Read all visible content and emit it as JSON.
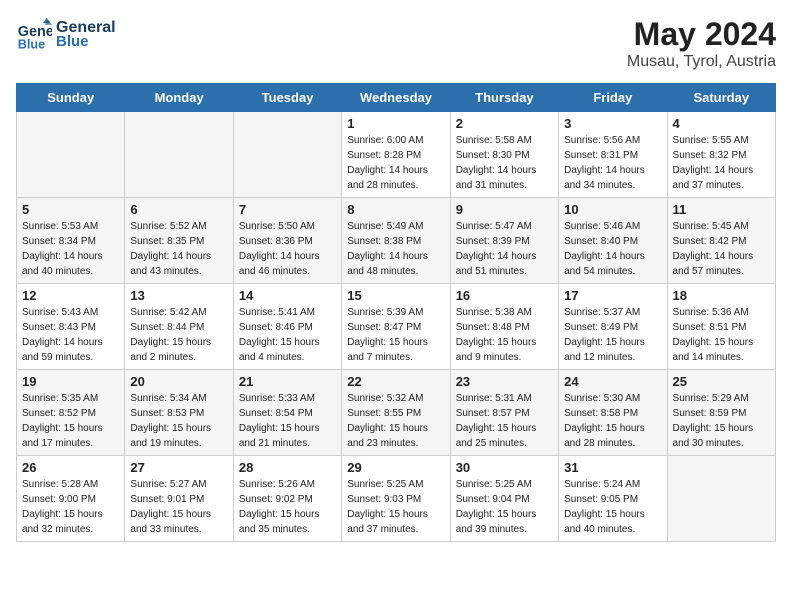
{
  "header": {
    "logo_line1": "General",
    "logo_line2": "Blue",
    "month": "May 2024",
    "location": "Musau, Tyrol, Austria"
  },
  "weekdays": [
    "Sunday",
    "Monday",
    "Tuesday",
    "Wednesday",
    "Thursday",
    "Friday",
    "Saturday"
  ],
  "weeks": [
    [
      {
        "day": "",
        "info": "",
        "empty": true
      },
      {
        "day": "",
        "info": "",
        "empty": true
      },
      {
        "day": "",
        "info": "",
        "empty": true
      },
      {
        "day": "1",
        "info": "Sunrise: 6:00 AM\nSunset: 8:28 PM\nDaylight: 14 hours\nand 28 minutes."
      },
      {
        "day": "2",
        "info": "Sunrise: 5:58 AM\nSunset: 8:30 PM\nDaylight: 14 hours\nand 31 minutes."
      },
      {
        "day": "3",
        "info": "Sunrise: 5:56 AM\nSunset: 8:31 PM\nDaylight: 14 hours\nand 34 minutes."
      },
      {
        "day": "4",
        "info": "Sunrise: 5:55 AM\nSunset: 8:32 PM\nDaylight: 14 hours\nand 37 minutes."
      }
    ],
    [
      {
        "day": "5",
        "info": "Sunrise: 5:53 AM\nSunset: 8:34 PM\nDaylight: 14 hours\nand 40 minutes."
      },
      {
        "day": "6",
        "info": "Sunrise: 5:52 AM\nSunset: 8:35 PM\nDaylight: 14 hours\nand 43 minutes."
      },
      {
        "day": "7",
        "info": "Sunrise: 5:50 AM\nSunset: 8:36 PM\nDaylight: 14 hours\nand 46 minutes."
      },
      {
        "day": "8",
        "info": "Sunrise: 5:49 AM\nSunset: 8:38 PM\nDaylight: 14 hours\nand 48 minutes."
      },
      {
        "day": "9",
        "info": "Sunrise: 5:47 AM\nSunset: 8:39 PM\nDaylight: 14 hours\nand 51 minutes."
      },
      {
        "day": "10",
        "info": "Sunrise: 5:46 AM\nSunset: 8:40 PM\nDaylight: 14 hours\nand 54 minutes."
      },
      {
        "day": "11",
        "info": "Sunrise: 5:45 AM\nSunset: 8:42 PM\nDaylight: 14 hours\nand 57 minutes."
      }
    ],
    [
      {
        "day": "12",
        "info": "Sunrise: 5:43 AM\nSunset: 8:43 PM\nDaylight: 14 hours\nand 59 minutes."
      },
      {
        "day": "13",
        "info": "Sunrise: 5:42 AM\nSunset: 8:44 PM\nDaylight: 15 hours\nand 2 minutes."
      },
      {
        "day": "14",
        "info": "Sunrise: 5:41 AM\nSunset: 8:46 PM\nDaylight: 15 hours\nand 4 minutes."
      },
      {
        "day": "15",
        "info": "Sunrise: 5:39 AM\nSunset: 8:47 PM\nDaylight: 15 hours\nand 7 minutes."
      },
      {
        "day": "16",
        "info": "Sunrise: 5:38 AM\nSunset: 8:48 PM\nDaylight: 15 hours\nand 9 minutes."
      },
      {
        "day": "17",
        "info": "Sunrise: 5:37 AM\nSunset: 8:49 PM\nDaylight: 15 hours\nand 12 minutes."
      },
      {
        "day": "18",
        "info": "Sunrise: 5:36 AM\nSunset: 8:51 PM\nDaylight: 15 hours\nand 14 minutes."
      }
    ],
    [
      {
        "day": "19",
        "info": "Sunrise: 5:35 AM\nSunset: 8:52 PM\nDaylight: 15 hours\nand 17 minutes."
      },
      {
        "day": "20",
        "info": "Sunrise: 5:34 AM\nSunset: 8:53 PM\nDaylight: 15 hours\nand 19 minutes."
      },
      {
        "day": "21",
        "info": "Sunrise: 5:33 AM\nSunset: 8:54 PM\nDaylight: 15 hours\nand 21 minutes."
      },
      {
        "day": "22",
        "info": "Sunrise: 5:32 AM\nSunset: 8:55 PM\nDaylight: 15 hours\nand 23 minutes."
      },
      {
        "day": "23",
        "info": "Sunrise: 5:31 AM\nSunset: 8:57 PM\nDaylight: 15 hours\nand 25 minutes."
      },
      {
        "day": "24",
        "info": "Sunrise: 5:30 AM\nSunset: 8:58 PM\nDaylight: 15 hours\nand 28 minutes."
      },
      {
        "day": "25",
        "info": "Sunrise: 5:29 AM\nSunset: 8:59 PM\nDaylight: 15 hours\nand 30 minutes."
      }
    ],
    [
      {
        "day": "26",
        "info": "Sunrise: 5:28 AM\nSunset: 9:00 PM\nDaylight: 15 hours\nand 32 minutes."
      },
      {
        "day": "27",
        "info": "Sunrise: 5:27 AM\nSunset: 9:01 PM\nDaylight: 15 hours\nand 33 minutes."
      },
      {
        "day": "28",
        "info": "Sunrise: 5:26 AM\nSunset: 9:02 PM\nDaylight: 15 hours\nand 35 minutes."
      },
      {
        "day": "29",
        "info": "Sunrise: 5:25 AM\nSunset: 9:03 PM\nDaylight: 15 hours\nand 37 minutes."
      },
      {
        "day": "30",
        "info": "Sunrise: 5:25 AM\nSunset: 9:04 PM\nDaylight: 15 hours\nand 39 minutes."
      },
      {
        "day": "31",
        "info": "Sunrise: 5:24 AM\nSunset: 9:05 PM\nDaylight: 15 hours\nand 40 minutes."
      },
      {
        "day": "",
        "info": "",
        "empty": true
      }
    ]
  ]
}
